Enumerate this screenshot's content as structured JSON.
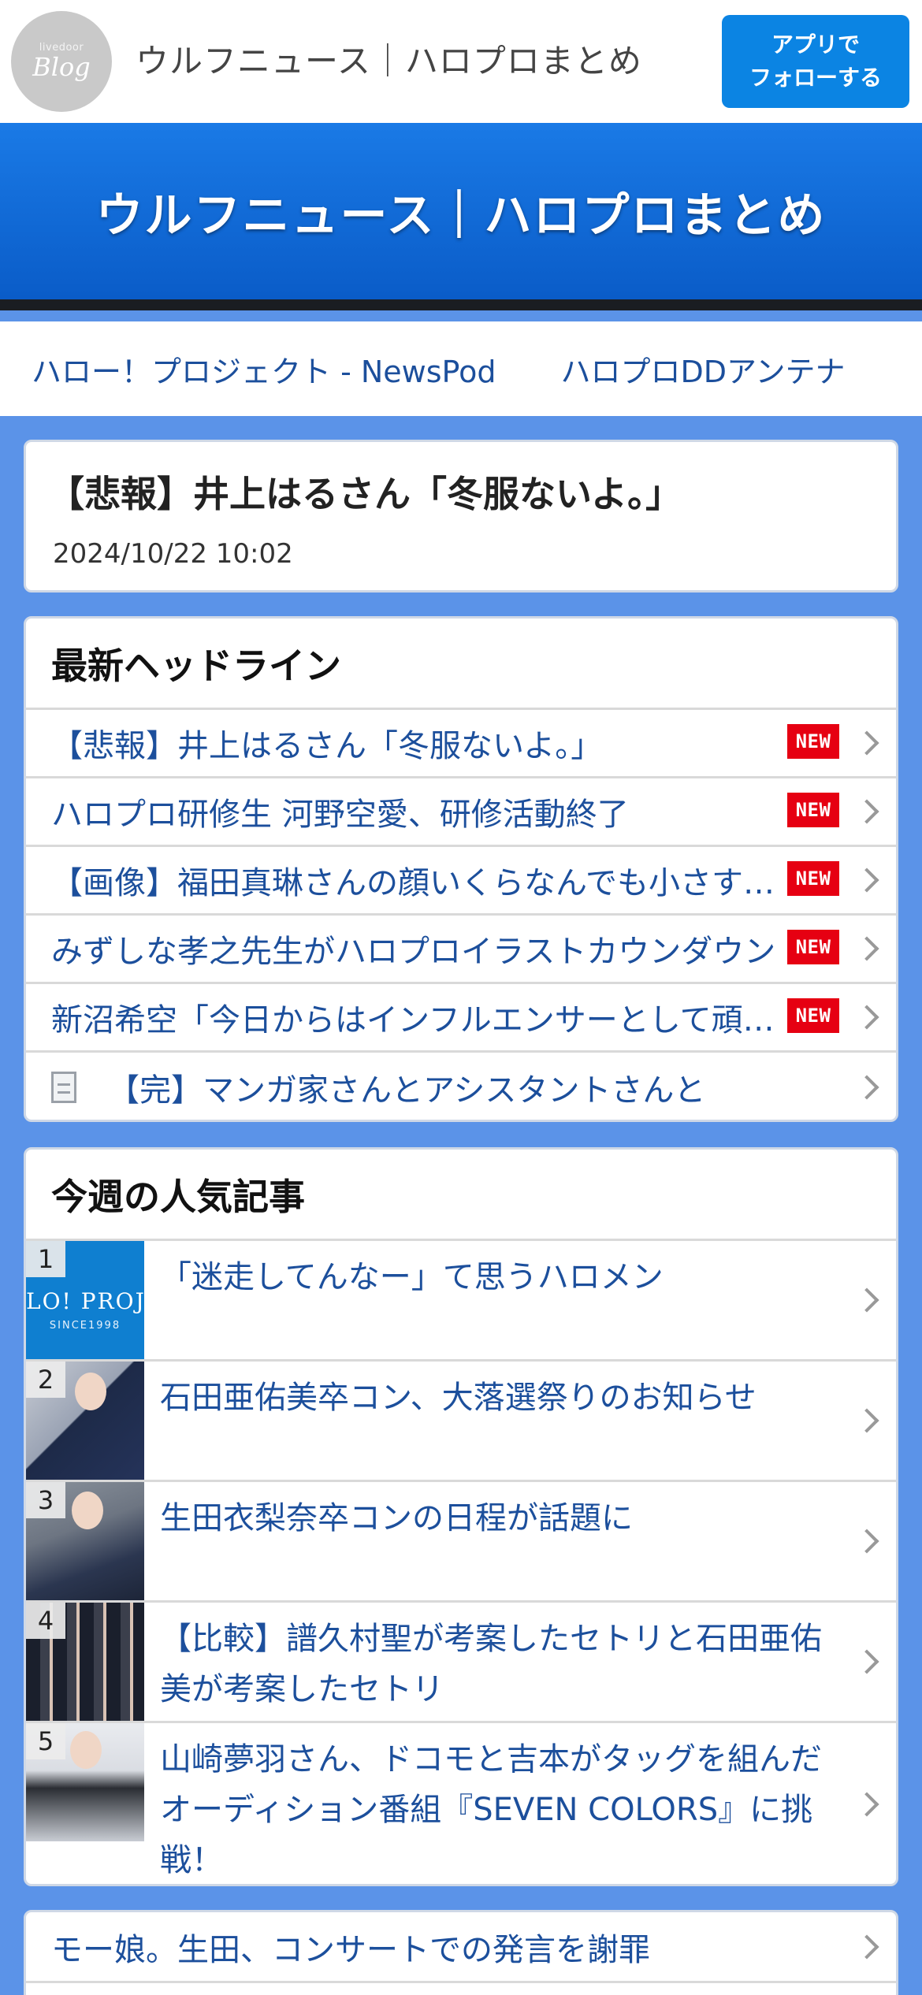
{
  "topbar": {
    "logo_small": "livedoor",
    "logo_main": "Blog",
    "title": "ウルフニュース｜ハロプロまとめ",
    "follow_line1": "アプリで",
    "follow_line2": "フォローする"
  },
  "banner": {
    "title": "ウルフニュース｜ハロプロまとめ"
  },
  "linknav": [
    "ハロー！プロジェクト - NewsPod",
    "ハロプロDDアンテナ"
  ],
  "article": {
    "title": "【悲報】井上はるさん「冬服ないよ。」",
    "date": "2024/10/22 10:02"
  },
  "headlines": {
    "heading": "最新ヘッドライン",
    "new_label": "NEW",
    "items": [
      {
        "text": "【悲報】井上はるさん「冬服ないよ。」",
        "new": true
      },
      {
        "text": "ハロプロ研修生 河野空愛、研修活動終了",
        "new": true
      },
      {
        "text": "【画像】福田真琳さんの顔いくらなんでも小さすぎる",
        "new": true
      },
      {
        "text": "みずしな孝之先生がハロプロイラストカウンダウン",
        "new": true
      },
      {
        "text": "新沼希空「今日からはインフルエンサーとして頑張ります」",
        "new": true
      },
      {
        "text": "【完】マンガ家さんとアシスタントさんと",
        "new": false
      }
    ]
  },
  "ranking": {
    "heading": "今週の人気記事",
    "thumb1_line1": "LO! PROJ",
    "thumb1_line2": "SINCE1998",
    "items": [
      {
        "rank": "1",
        "text": "「迷走してんなー」て思うハロメン"
      },
      {
        "rank": "2",
        "text": "石田亜佑美卒コン、大落選祭りのお知らせ"
      },
      {
        "rank": "3",
        "text": "生田衣梨奈卒コンの日程が話題に"
      },
      {
        "rank": "4",
        "text": "【比較】譜久村聖が考案したセトリと石田亜佑美が考案したセトリ"
      },
      {
        "rank": "5",
        "text": "山崎夢羽さん、ドコモと吉本がタッグを組んだオーディション番組『SEVEN COLORS』に挑戦！"
      }
    ]
  },
  "bottom_list": [
    "モー娘。生田、コンサートでの発言を謝罪"
  ]
}
